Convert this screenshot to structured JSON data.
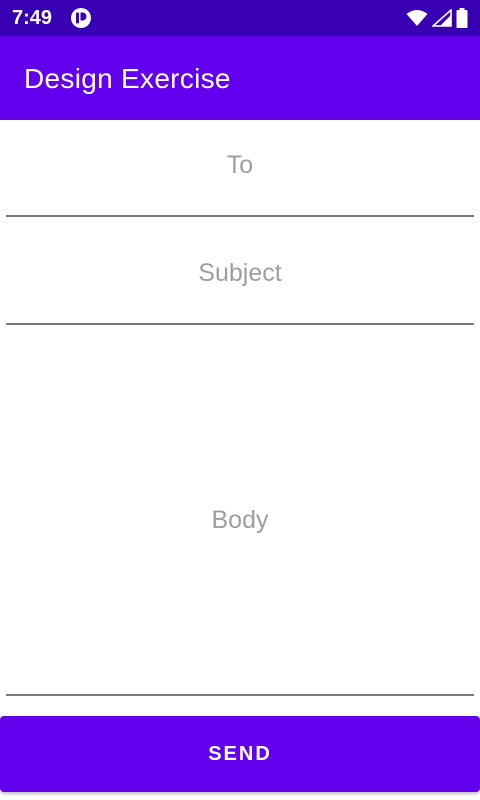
{
  "status_bar": {
    "time": "7:49",
    "app_icon": "notification-app-icon",
    "icons": [
      "wifi-icon",
      "cell-signal-icon",
      "battery-icon"
    ],
    "background": "#3700b3"
  },
  "app_bar": {
    "title": "Design Exercise",
    "background": "#6200ee"
  },
  "form": {
    "to": {
      "placeholder": "To",
      "value": ""
    },
    "subject": {
      "placeholder": "Subject",
      "value": ""
    },
    "body": {
      "placeholder": "Body",
      "value": ""
    }
  },
  "actions": {
    "send_label": "SEND",
    "send_color": "#6200ee"
  }
}
